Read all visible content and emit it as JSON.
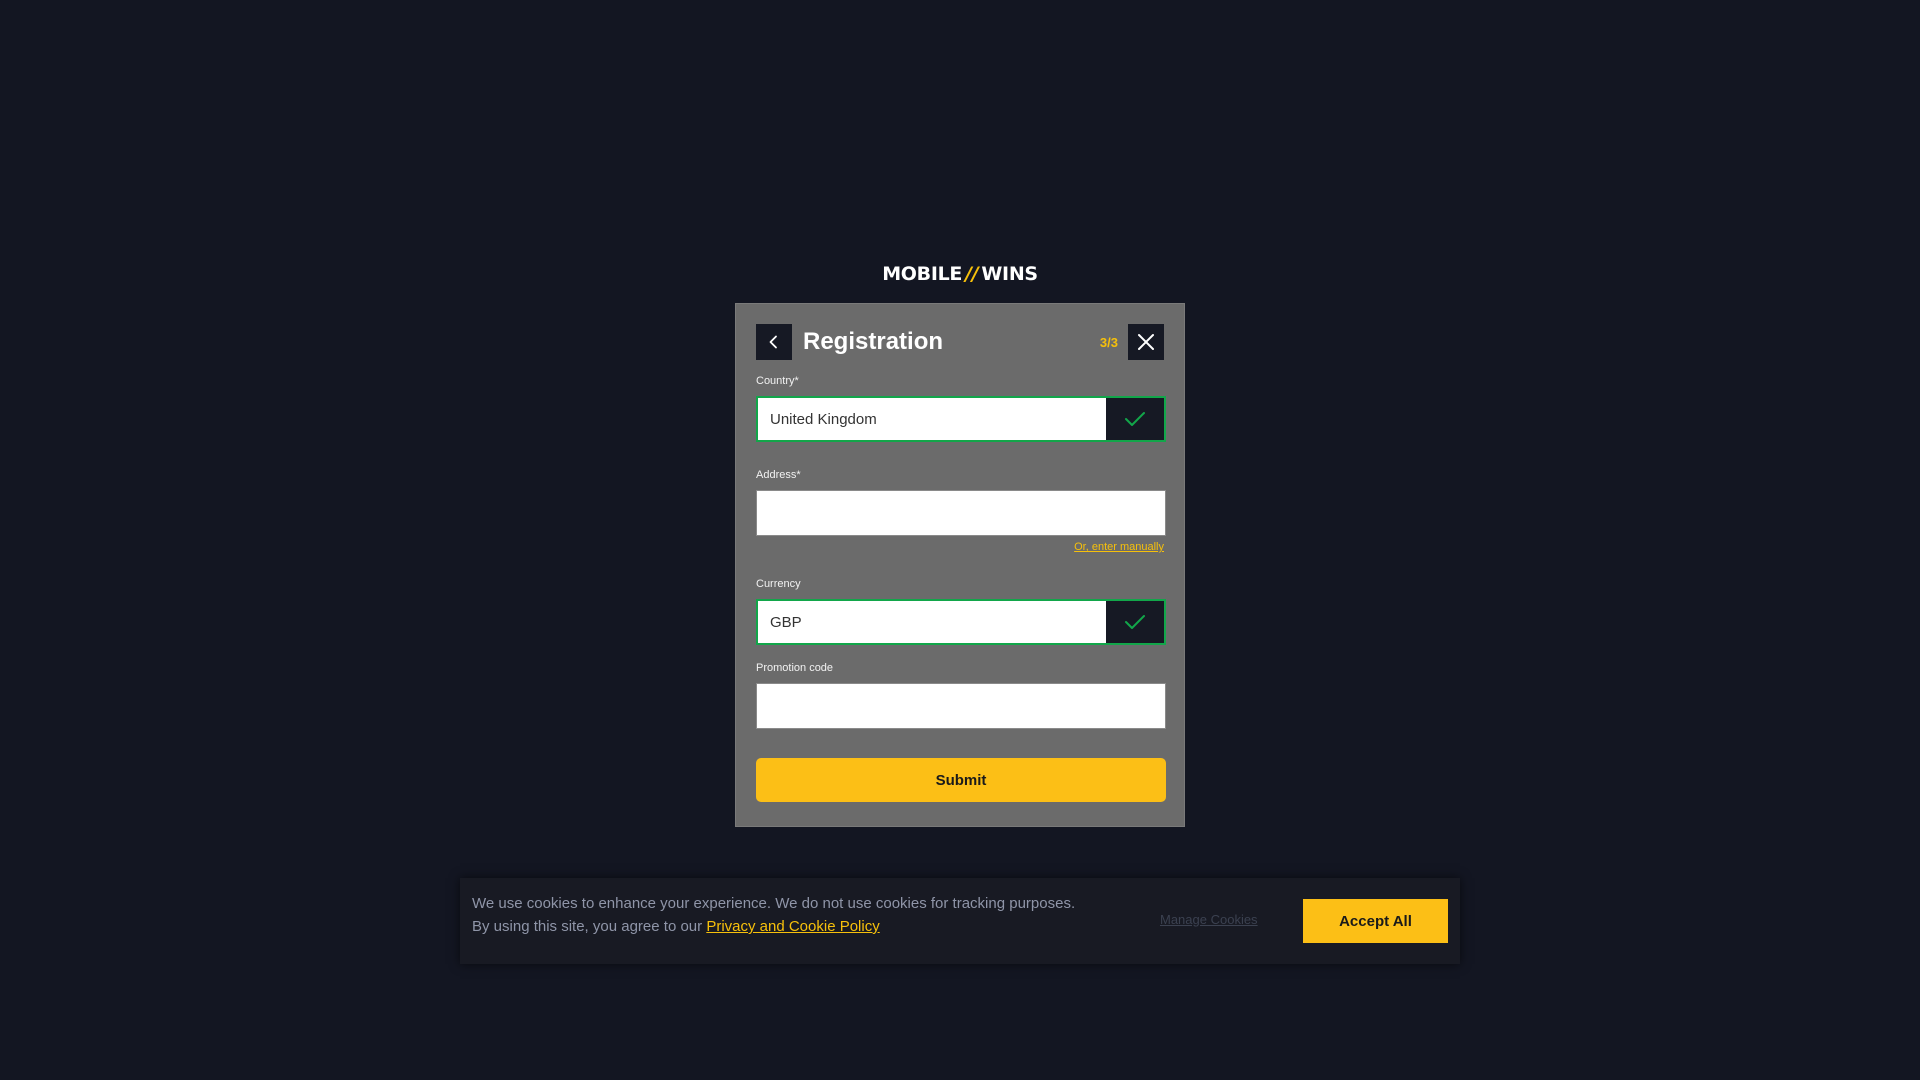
{
  "logo": {
    "left": "MOBILE",
    "separator": "//",
    "right": "WINS"
  },
  "modal": {
    "title": "Registration",
    "step": "3/3",
    "back_icon": "chevron-left-icon",
    "close_icon": "close-icon"
  },
  "form": {
    "country": {
      "label": "Country*",
      "value": "United Kingdom",
      "status_icon": "check-icon"
    },
    "address": {
      "label": "Address*",
      "value": "",
      "manual_link": "Or, enter manually"
    },
    "currency": {
      "label": "Currency",
      "value": "GBP",
      "status_icon": "check-icon"
    },
    "promotion": {
      "label": "Promotion code",
      "value": ""
    },
    "submit_label": "Submit"
  },
  "cookie": {
    "text_line1": "We use cookies to enhance your experience. We do not use cookies for tracking purposes.",
    "text_line2": "By using this site, you agree to our",
    "policy_link": "Privacy and Cookie Policy",
    "manage_label": "Manage Cookies",
    "accept_label": "Accept All"
  },
  "colors": {
    "background": "#131622",
    "modal": "#6b6b6b",
    "accent": "#fcbf16",
    "valid": "#12a64a"
  }
}
